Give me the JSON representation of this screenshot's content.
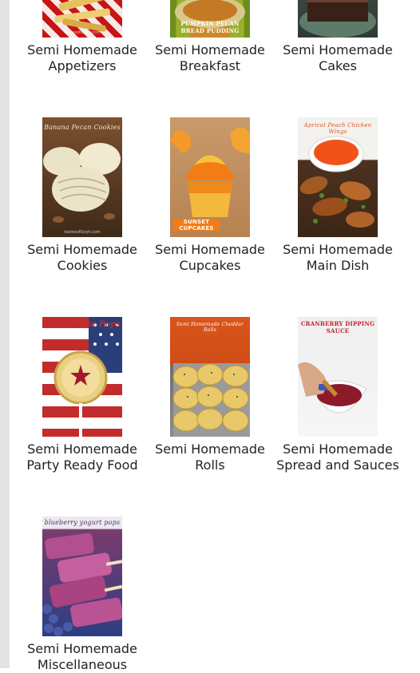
{
  "watermark": "tastesoflizzyt.com",
  "categories": [
    {
      "line1": "Semi Homemade",
      "line2": "Appetizers"
    },
    {
      "line1": "Semi Homemade",
      "line2": "Breakfast",
      "thumb_text": "PUMPKIN PECAN BREAD PUDDING"
    },
    {
      "line1": "Semi Homemade",
      "line2": "Cakes"
    },
    {
      "line1": "Semi Homemade",
      "line2": "Cookies",
      "thumb_text": "Banana Pecan Cookies"
    },
    {
      "line1": "Semi Homemade",
      "line2": "Cupcakes",
      "thumb_text": "SUNSET CUPCAKES"
    },
    {
      "line1": "Semi Homemade",
      "line2": "Main Dish",
      "thumb_text": "Apricot Peach Chicken Wings"
    },
    {
      "line1": "Semi Homemade",
      "line2": "Party Ready Food",
      "thumb_text": "Cherry Pie Pops"
    },
    {
      "line1": "Semi Homemade",
      "line2": "Rolls",
      "thumb_text": "Semi Homemade Cheddar Rolls"
    },
    {
      "line1": "Semi Homemade",
      "line2": "Spread and Sauces",
      "thumb_text": "CRANBERRY DIPPING SAUCE"
    },
    {
      "line1": "Semi Homemade",
      "line2": "Miscellaneous",
      "thumb_text": "blueberry yogurt pops"
    }
  ]
}
